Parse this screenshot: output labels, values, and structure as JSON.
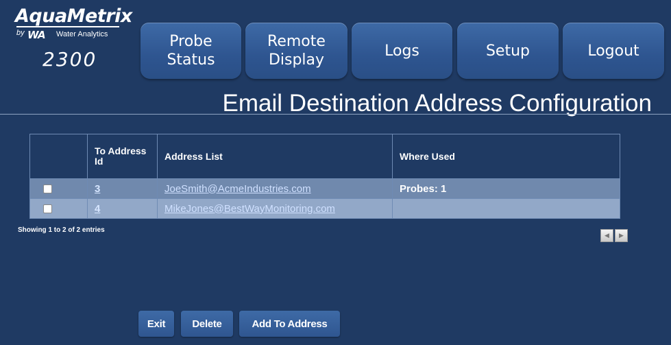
{
  "logo": {
    "brand": "AquaMetrix",
    "by": "by",
    "mark": "WA",
    "subtitle": "Water Analytics",
    "model": "2300"
  },
  "nav": [
    {
      "label": "Probe\nStatus"
    },
    {
      "label": "Remote\nDisplay"
    },
    {
      "label": "Logs"
    },
    {
      "label": "Setup"
    },
    {
      "label": "Logout"
    }
  ],
  "page": {
    "title": "Email Destination Address Configuration"
  },
  "table": {
    "headers": [
      "",
      "To Address Id",
      "Address List",
      "Where Used"
    ],
    "rows": [
      {
        "id": "3",
        "address": "JoeSmith@AcmeIndustries.com",
        "where_used": "Probes: 1",
        "checked": false
      },
      {
        "id": "4",
        "address": "MikeJones@BestWayMonitoring.com",
        "where_used": "",
        "checked": false
      }
    ],
    "info": "Showing 1 to 2 of 2 entries"
  },
  "pager": {
    "prev_icon": "triangle-left-icon",
    "next_icon": "triangle-right-icon"
  },
  "actions": {
    "exit": "Exit",
    "delete": "Delete",
    "add": "Add To Address"
  },
  "colors": {
    "background": "#1f3a63",
    "tab": "#2e5590",
    "row_a": "#7089ad",
    "row_b": "#92a8c8"
  }
}
